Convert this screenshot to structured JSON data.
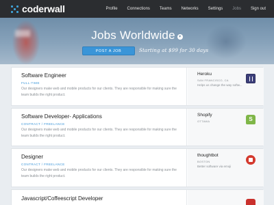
{
  "app": {
    "logo_text": "coderwall"
  },
  "nav": {
    "items": [
      {
        "label": "Profile",
        "active": false
      },
      {
        "label": "Connections",
        "active": false
      },
      {
        "label": "Teams",
        "active": false
      },
      {
        "label": "Networks",
        "active": false
      },
      {
        "label": "Settings",
        "active": false
      },
      {
        "label": "Jobs",
        "active": true
      },
      {
        "label": "Sign out",
        "active": false
      }
    ]
  },
  "hero": {
    "title": "Jobs Worldwide",
    "post_button": "POST A JOB",
    "tagline": "Starting at $99 for 30 days"
  },
  "jobs": [
    {
      "title": "Software Engineer",
      "type": "FULL-TIME",
      "description": "Our designers make web and mobile products for our clients. They are responsible for making sure the team builds the right product.",
      "company": "Heroku",
      "location": "SAN FRANCISCO, CA",
      "company_description": "Helps us change the way softw...",
      "logo_icon": "heroku-logo-icon"
    },
    {
      "title": "Software Developer- Applications",
      "type": "CONTRACT / FREELANCE",
      "description": "Our designers make web and mobile products for our clients. They are responsible for making sure the team builds the right product.",
      "company": "Shopify",
      "location": "OTTAWA",
      "company_description": "",
      "logo_icon": "shopify-logo-icon"
    },
    {
      "title": "Designer",
      "type": "CONTRACT / FREELANCE",
      "description": "Our designers make web and mobile products for our clients. They are responsible for making sure the team builds the right product.",
      "company": "thoughtbot",
      "location": "BOSTON",
      "company_description": "Better software via emoji",
      "logo_icon": "thoughtbot-logo-icon"
    },
    {
      "title": "Javascript/Coffeescript Developer",
      "type": "",
      "description": "",
      "company": "",
      "location": "",
      "company_description": "",
      "logo_icon": "company-logo-icon"
    }
  ],
  "colors": {
    "topbar": "#2b2d30",
    "accent": "#3a95d8",
    "hero": "#7d9ab3",
    "page_bg": "#e9edf1"
  }
}
